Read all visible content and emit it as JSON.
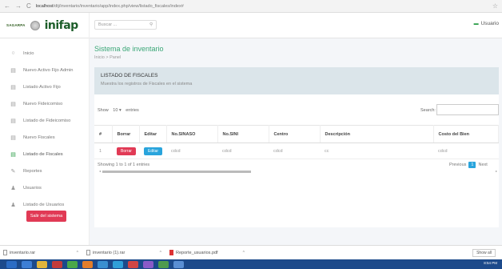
{
  "browser": {
    "back": "←",
    "forward": "→",
    "reload": "C",
    "url_host": "localhost",
    "url_path": "/dtj/inventario/inventario/app/index.php/view/listado_fiscales/index#",
    "star": "☆"
  },
  "topbar": {
    "brand_small": "SAGARPA",
    "logo": "inifap",
    "search_placeholder": "Buscar ...",
    "user_label": "Usuario"
  },
  "sidebar": {
    "items": [
      {
        "label": "Inicio",
        "icon": "○"
      },
      {
        "label": "Nuevo Activo Fijo Admin",
        "icon": "▤"
      },
      {
        "label": "Listado Activo Fijo",
        "icon": "▤"
      },
      {
        "label": "Nuevo Fideicomiso",
        "icon": "▤"
      },
      {
        "label": "Listado de Fideicomiso",
        "icon": "▤"
      },
      {
        "label": "Nuevo Fiscales",
        "icon": "▤"
      },
      {
        "label": "Listado de Fiscales",
        "icon": "▤"
      },
      {
        "label": "Reportes",
        "icon": "✎"
      },
      {
        "label": "Usuarios",
        "icon": "♟"
      },
      {
        "label": "Listado de Usuarios",
        "icon": "♟"
      }
    ],
    "logout": "Salir del sistema"
  },
  "main": {
    "title": "Sistema de inventario",
    "breadcrumb": "Inicio > Panel",
    "card_title": "LISTADO DE FISCALES",
    "card_subtitle": "Muestra los registros de Fiscales en el sistema",
    "show_label": "Show",
    "show_value": "10",
    "entries_label": "entries",
    "search_label": "Search:",
    "table": {
      "headers": [
        "#",
        "Borrar",
        "Editar",
        "No.SINASO",
        "No.SINI",
        "Centro",
        "Descripción",
        "Costo del Bien"
      ],
      "rows": [
        {
          "num": "1",
          "delete": "Borrar",
          "edit": "Editar",
          "sinaso": "cdcd",
          "sini": "cdcd",
          "centro": "cdcd",
          "descripcion": "cc",
          "costo": "cdcd"
        }
      ]
    },
    "info": "Showing 1 to 1 of 1 entries",
    "prev": "Previous",
    "page": "1",
    "next": "Next"
  },
  "downloads": {
    "items": [
      {
        "name": "inventario.rar",
        "type": "file"
      },
      {
        "name": "inventario (1).rar",
        "type": "file"
      },
      {
        "name": "Reporte_usuarios.pdf",
        "type": "pdf"
      }
    ],
    "show_all": "Show all"
  },
  "taskbar": {
    "clock": "8:54 PM"
  },
  "colors": {
    "accent": "#3aa777",
    "danger": "#e13a55",
    "info": "#29a4dc",
    "taskbar": "#1c4a8b"
  }
}
